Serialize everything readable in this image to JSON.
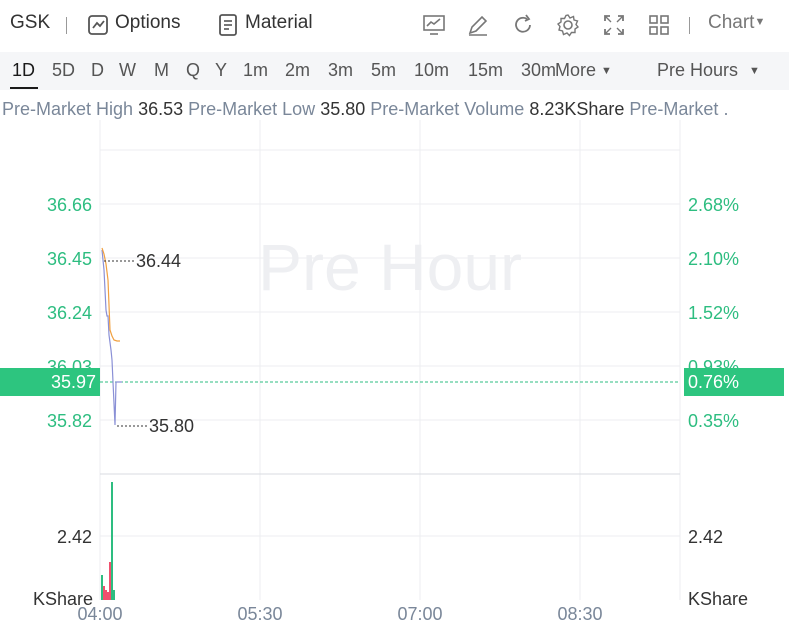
{
  "toolbar": {
    "symbol": "GSK",
    "options_label": "Options",
    "material_label": "Material",
    "chart_label": "Chart",
    "icons": [
      "indicator-icon",
      "draw-icon",
      "refresh-icon",
      "settings-icon",
      "fullscreen-icon",
      "layout-icon"
    ]
  },
  "periods": {
    "items": [
      "1D",
      "5D",
      "D",
      "W",
      "M",
      "Q",
      "Y",
      "1m",
      "2m",
      "3m",
      "5m",
      "10m",
      "15m",
      "30m"
    ],
    "active": "1D",
    "more_label": "More",
    "session_label": "Pre Hours"
  },
  "info": {
    "high_label": "Pre-Market High",
    "high_value": "36.53",
    "low_label": "Pre-Market Low",
    "low_value": "35.80",
    "volume_label": "Pre-Market Volume",
    "volume_value": "8.23KShare",
    "extra_label": "Pre-Market ."
  },
  "chart_data": {
    "type": "line",
    "watermark": "Pre Hour",
    "price_axis_left": [
      "36.66",
      "36.45",
      "36.24",
      "36.03",
      "35.82"
    ],
    "percent_axis_right": [
      "2.68%",
      "2.10%",
      "1.52%",
      "0.93%",
      "0.35%"
    ],
    "current_price": "35.97",
    "current_percent": "0.76%",
    "max_label": "36.44",
    "min_label": "35.80",
    "volume_axis_value": "2.42",
    "volume_unit": "KShare",
    "time_labels": [
      "04:00",
      "05:30",
      "07:00",
      "08:30"
    ],
    "ylim": [
      35.75,
      36.75
    ],
    "colors": {
      "up": "#2dbd80",
      "down": "#f0506e",
      "price_line": "#8a90d6",
      "avg_line": "#f0a040"
    }
  }
}
